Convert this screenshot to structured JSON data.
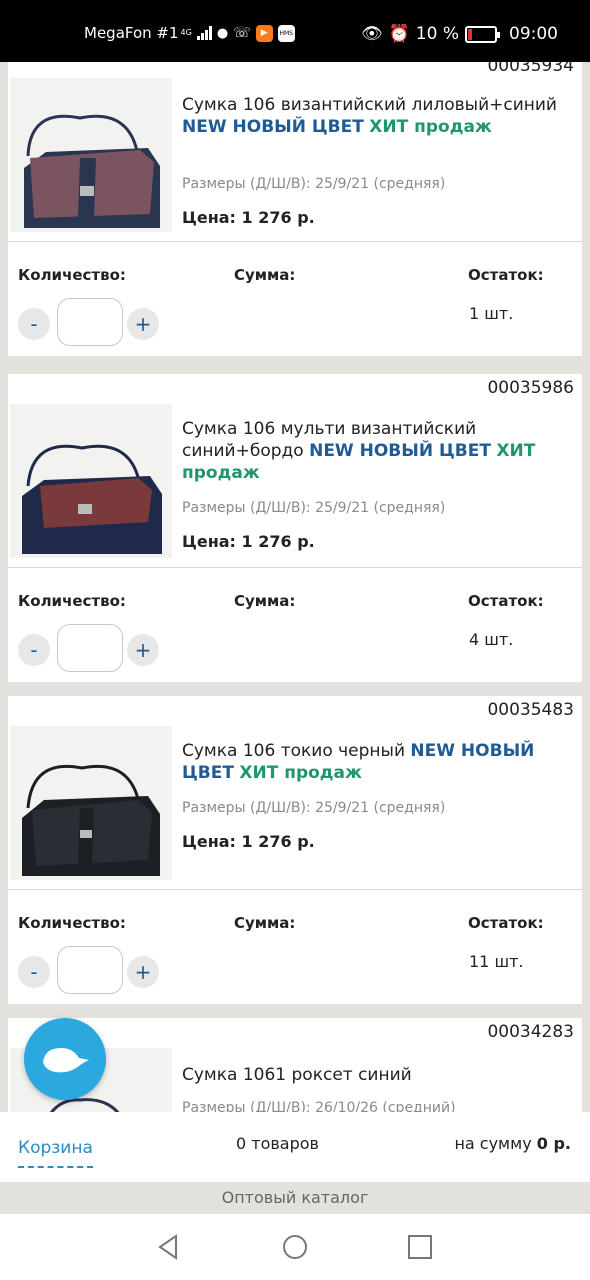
{
  "status": {
    "carrier": "MegaFon #1",
    "network": "4G",
    "app_badge": "HMS",
    "battery": "10 %",
    "time": "09:00"
  },
  "labels": {
    "quantity": "Количество:",
    "sum": "Сумма:",
    "stock": "Остаток:",
    "minus": "-",
    "plus": "+"
  },
  "products": [
    {
      "number": "64",
      "article": "00035934",
      "name": "Сумка 106 византийский лиловый+синий",
      "tag_new": "NEW НОВЫЙ ЦВЕТ",
      "tag_hit": "ХИТ продаж",
      "sizes": "Размеры (Д/Ш/В): 25/9/21 (средняя)",
      "price": "Цена: 1 276 р.",
      "stock": "1 шт.",
      "color_body": "#7a5560",
      "color_trim": "#2a3550"
    },
    {
      "number": "65",
      "article": "00035986",
      "name": "Сумка 106 мульти византийский синий+бордо",
      "tag_new": "NEW НОВЫЙ ЦВЕТ",
      "tag_hit": "ХИТ продаж",
      "sizes": "Размеры (Д/Ш/В): 25/9/21 (средняя)",
      "price": "Цена: 1 276 р.",
      "stock": "4 шт.",
      "color_body": "#1f2a4a",
      "color_trim": "#7a3a3c"
    },
    {
      "number": "66",
      "article": "00035483",
      "name": "Сумка 106 токио черный",
      "tag_new": "NEW НОВЫЙ ЦВЕТ",
      "tag_hit": "ХИТ продаж",
      "sizes": "Размеры (Д/Ш/В): 25/9/21 (средняя)",
      "price": "Цена: 1 276 р.",
      "stock": "11 шт.",
      "color_body": "#2a2d33",
      "color_trim": "#1c1f24"
    },
    {
      "number": "67",
      "article": "00034283",
      "name": "Сумка 1061 роксет синий",
      "sizes": "Размеры (Д/Ш/В): 26/10/26 (средний)"
    }
  ],
  "cart": {
    "label": "Корзина",
    "count": "0 товаров",
    "sum_prefix": "на сумму",
    "sum_value": "0 р."
  },
  "catalog": "Оптовый каталог",
  "colors": {
    "accent_blue": "#1f5a95",
    "hit_green": "#21966a",
    "chat_blue": "#2ba8dd"
  }
}
